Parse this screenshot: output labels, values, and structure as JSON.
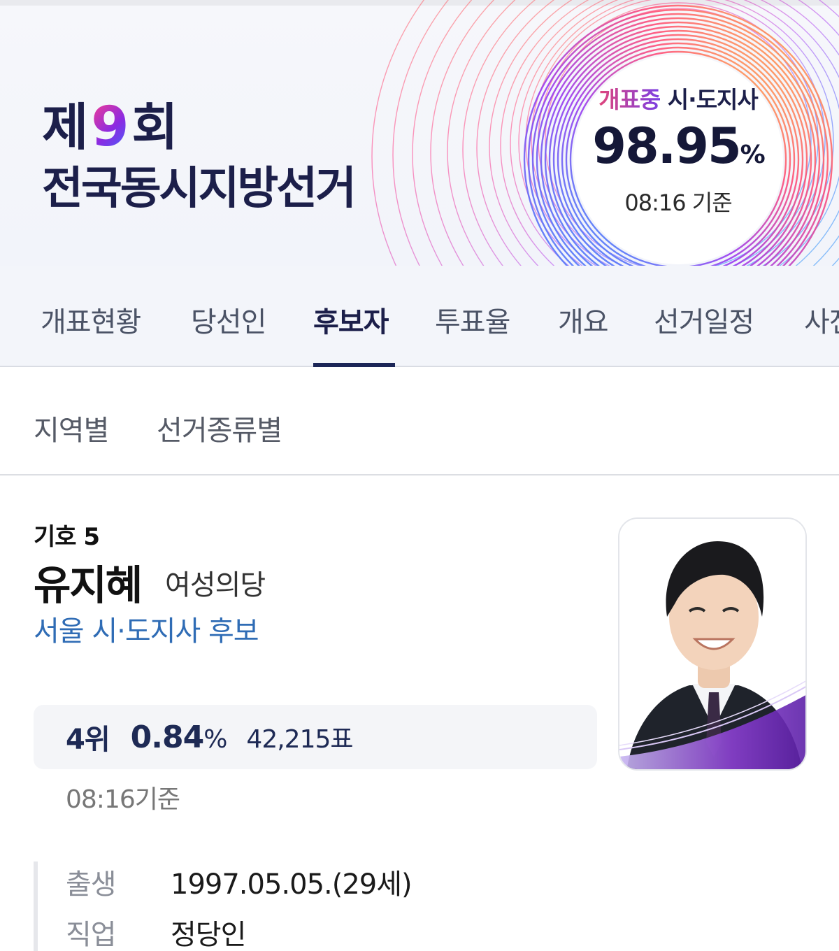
{
  "banner": {
    "title_prefix": "제",
    "title_number": "9",
    "title_suffix": "회",
    "title_line2": "전국동시지방선거",
    "count_status": "개표중",
    "count_type": "시·도지사",
    "count_percent": "98.95",
    "count_unit": "%",
    "count_time": "08:16 기준",
    "colors": {
      "navy": "#1c1f4a",
      "pink": "#ff3d8b",
      "purple": "#8a2be2",
      "blue": "#3a6bff"
    }
  },
  "tabs": [
    {
      "label": "개표현황",
      "active": false
    },
    {
      "label": "당선인",
      "active": false
    },
    {
      "label": "후보자",
      "active": true
    },
    {
      "label": "투표율",
      "active": false
    },
    {
      "label": "개요",
      "active": false
    },
    {
      "label": "선거일정",
      "active": false
    },
    {
      "label": "사전",
      "active": false
    }
  ],
  "subtabs": [
    {
      "label": "지역별"
    },
    {
      "label": "선거종류별"
    }
  ],
  "candidate": {
    "symbol": "기호 5",
    "name": "유지혜",
    "party": "여성의당",
    "role": "서울 시·도지사 후보",
    "photo_icon": "candidate-photo",
    "result": {
      "rank": "4위",
      "percent": "0.84",
      "percent_unit": "%",
      "votes": "42,215표",
      "time": "08:16기준"
    },
    "info": [
      {
        "label": "출생",
        "value": "1997.05.05.(29세)"
      },
      {
        "label": "직업",
        "value": "정당인"
      }
    ]
  }
}
